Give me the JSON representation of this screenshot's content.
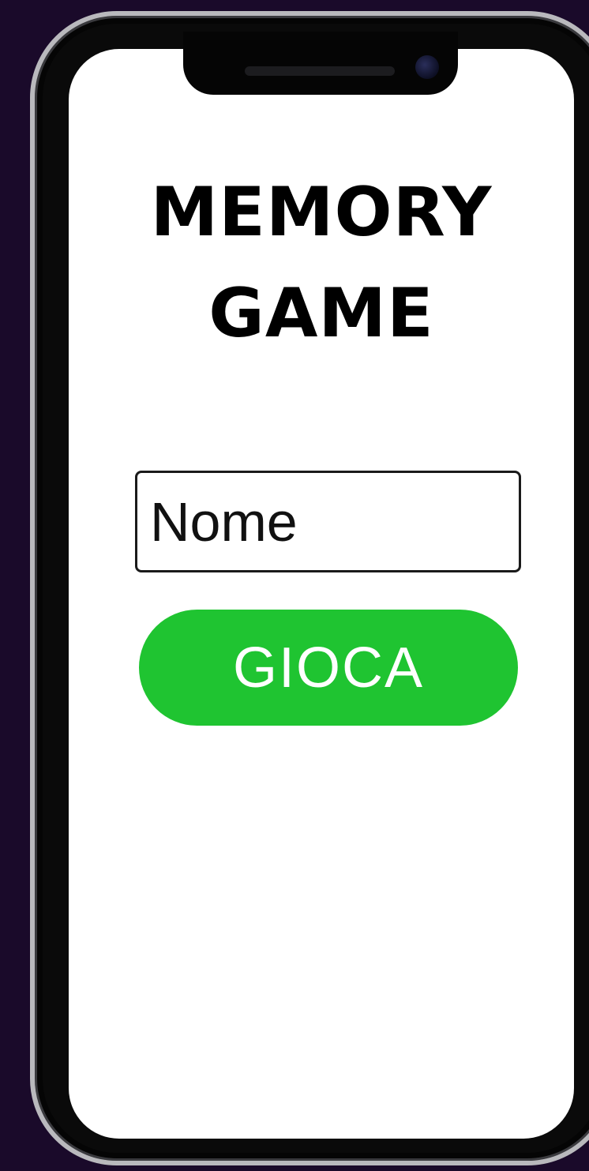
{
  "game": {
    "title_line1": "MEMORY",
    "title_line2": "GAME"
  },
  "form": {
    "name_placeholder": "Nome",
    "play_label": "GIOCA"
  },
  "colors": {
    "background": "#1a0a2a",
    "screen": "#ffffff",
    "play_button": "#1fc431",
    "text": "#000000"
  }
}
